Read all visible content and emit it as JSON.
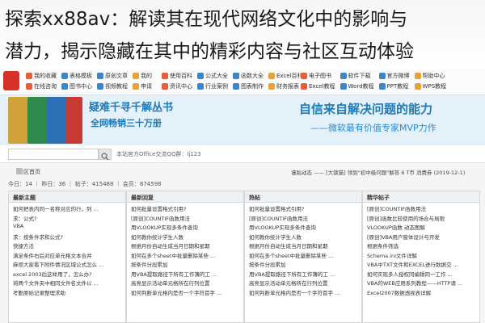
{
  "headline": {
    "line1": "探索xx88av：解读其在现代网络文化中的影响与",
    "line2": "潜力，揭示隐藏在其中的精彩内容与社区互动体验"
  },
  "nav": {
    "groups": [
      [
        "我的收藏",
        "表格模板",
        "原创文章",
        "我的",
        "在线咨询",
        "图书中心",
        "视频教程",
        "申请"
      ],
      [
        "使用百科",
        "公式大全",
        "函数大全",
        "Excel百科",
        "资讯中心",
        "行业案例",
        "图表制作",
        "财务报表"
      ],
      [
        "电子图书",
        "软件下载",
        "官方微博",
        "帮助中心",
        "Excel教程",
        "Word教程",
        "PPT教程",
        "WPS教程"
      ]
    ],
    "colors": [
      "#e65d3b",
      "#3a86c8",
      "#3a86c8",
      "#e6a23b"
    ]
  },
  "banner": {
    "title": "疑难千寻千解丛书",
    "subtitle": "全网畅销三十万册",
    "right_title": "自信来自解决问题的能力",
    "right_sub": "——微软最有价值专家MVP力作"
  },
  "search": {
    "button_icon": "search-icon",
    "text": "本站官方Office交流QQ群：lj123"
  },
  "breadcrumb": "社区首页",
  "stats": "今日：14 ｜ 昨日：36 ｜ 帖子：415488 ｜ 会员：874598",
  "notice": "谨贴动态 —— [大锁猫] 领到\"初中级问题\"解答 6 T币 消费券  (2019-12-1)",
  "panels": [
    {
      "title": "最新主题",
      "items": [
        "如何把表内同一名称对应的行，列 ...",
        "求：公式?",
        "VBA",
        "求：按条件求和公式?",
        "快捷方法",
        "满足条件右后对应单元格文本合并",
        "麻烦大家看下附件情况区域公式怎么 ...",
        "excel 2003后这样用了，怎么办?",
        "将两个文件夹中相同文件名文件以 ...",
        "考勤原始记录整理求助"
      ]
    },
    {
      "title": "最新回复",
      "items": [
        "如何批量设置格式引用?",
        "[原创]COUNTIF函数用法",
        "用VLOOKUP实现多条件查询",
        "如何教你统计学生人数",
        "根据月份自动生成当月日期和星期",
        "如何在多个sheet中批量删除某些 ...",
        "按条件分段累加",
        "用VBA提取路径下所有工作簿的工 ...",
        "高亮显示活动单元格所在行列位置",
        "如何判断单元格内是否一个字符首字 ..."
      ]
    },
    {
      "title": "热帖",
      "items": [
        "如何批量设置格式引用?",
        "[原创]COUNTIF函数用法",
        "用VLOOKUP实现多条件查询",
        "如何教你统计学生人数",
        "根据月份自动生成当月日期和星期",
        "如何在多个sheet中批量删除某些 ...",
        "按条件分段累加",
        "用VBA提取路径下所有工作簿的工 ...",
        "高亮显示活动单元格所在行列位置",
        "如何判断单元格内是否一个字符首字 ..."
      ]
    },
    {
      "title": "精华帖子",
      "items": [
        "[原创]COUNTIF函数用法",
        "[原创]函数比较使用的场合与局限",
        "VLOOKUP函数 动态图解",
        "[原创]VBA用户窗体设计与开发",
        "根据条件筛选",
        "Schema.ini文件详解",
        "VBA中TXT文件和EXCEL进行数据交 ...",
        "如何实现多人授权同编辑同一工作 ...",
        "VBA的WEB应用系列教程——HTTP请 ...",
        "Excel2007数据透视表详解"
      ]
    }
  ]
}
